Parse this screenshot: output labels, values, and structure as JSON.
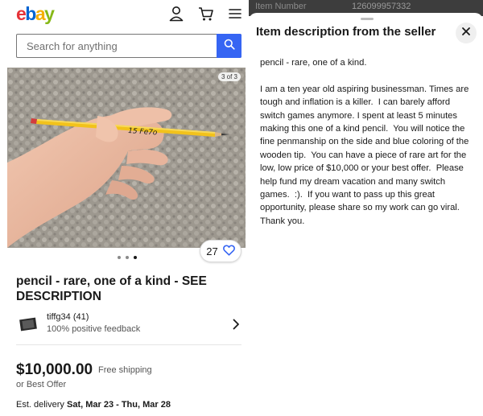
{
  "header": {
    "logo": {
      "e": "e",
      "b": "b",
      "a": "a",
      "y": "y"
    },
    "search": {
      "placeholder": "Search for anything"
    }
  },
  "listing": {
    "photo_counter": "3 of 3",
    "photo_dots": {
      "total": 3,
      "active": 3
    },
    "pencil_handwriting": "15 Fe7o",
    "watch_count": "27",
    "title": "pencil - rare, one of a kind - SEE DESCRIPTION",
    "seller": {
      "name": "tiffg34 (41)",
      "feedback": "100% positive feedback"
    },
    "price": "$10,000.00",
    "shipping": "Free shipping",
    "best_offer": "or Best Offer",
    "delivery_label": "Est. delivery",
    "delivery_dates": "Sat, Mar 23 - Thu, Mar 28"
  },
  "background_row": {
    "label": "Item Number",
    "value": "126099957332"
  },
  "description_sheet": {
    "title": "Item description from the seller",
    "text": "pencil - rare, one of a kind.\n\nI am a ten year old aspiring businessman. Times are tough and inflation is a killer.  I can barely afford switch games anymore. I spent at least 5 minutes making this one of a kind pencil.  You will notice the fine penmanship on the side and blue coloring of the wooden tip.  You can have a piece of rare art for the low, low price of $10,000 or your best offer.  Please help fund my dream vacation and many switch games.  :).  If you want to pass up this great opportunity, please share so my work can go viral.  Thank you."
  },
  "colors": {
    "accent_blue": "#3665f3",
    "logo_red": "#e53238",
    "logo_blue": "#0064d2",
    "logo_yellow": "#f5af02",
    "logo_green": "#86b817",
    "pencil_yellow": "#f2c21b"
  },
  "icons": [
    "user-icon",
    "cart-icon",
    "menu-icon",
    "search-icon",
    "heart-icon",
    "chevron-right-icon",
    "close-icon"
  ]
}
